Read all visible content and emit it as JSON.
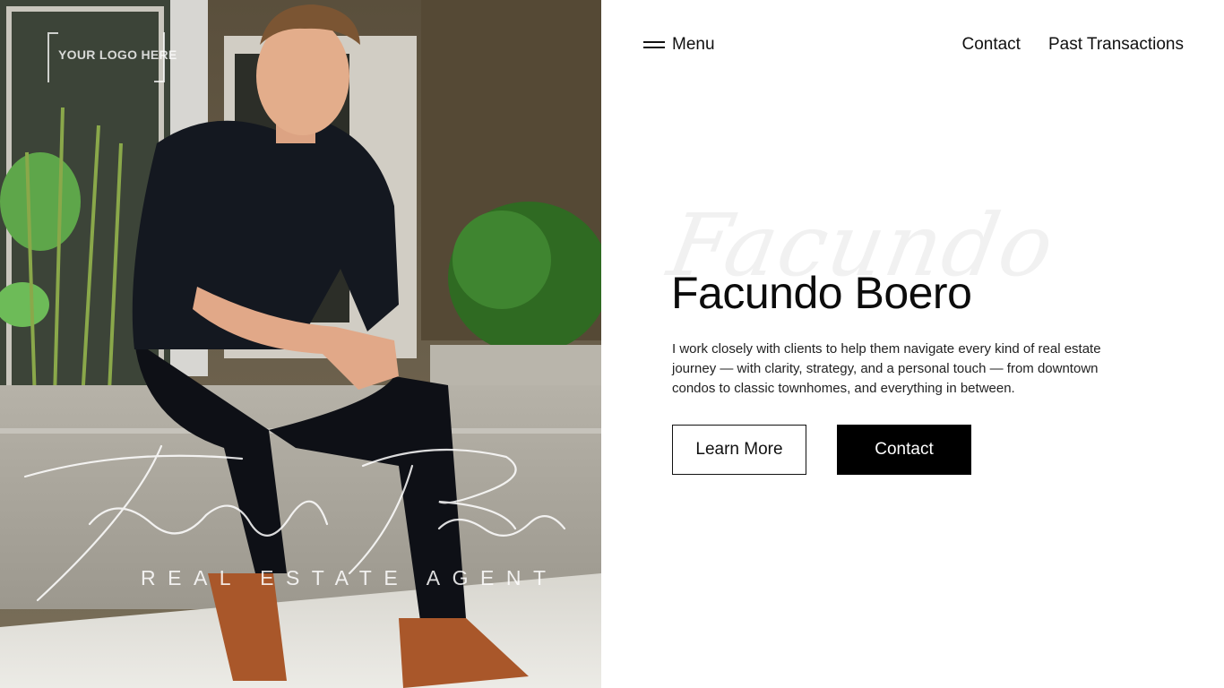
{
  "hero_photo": {
    "logo_text": "YOUR LOGO HERE",
    "signature_name": "Facundo Boero",
    "tagline": "REAL ESTATE AGENT"
  },
  "nav": {
    "menu_label": "Menu",
    "links": [
      {
        "label": "Contact"
      },
      {
        "label": "Past Transactions"
      }
    ]
  },
  "hero": {
    "script_watermark": "Facundo",
    "name": "Facundo Boero",
    "description": "I work closely with clients to help them navigate every kind of real estate journey — with clarity, strategy, and a personal touch — from downtown condos to classic townhomes, and everything in between.",
    "buttons": {
      "learn_more": "Learn More",
      "contact": "Contact"
    }
  },
  "colors": {
    "background": "#ffffff",
    "text": "#111111",
    "primary_button": "#000000",
    "watermark": "#f1f1f1"
  },
  "icons": {
    "menu": "hamburger-icon"
  }
}
